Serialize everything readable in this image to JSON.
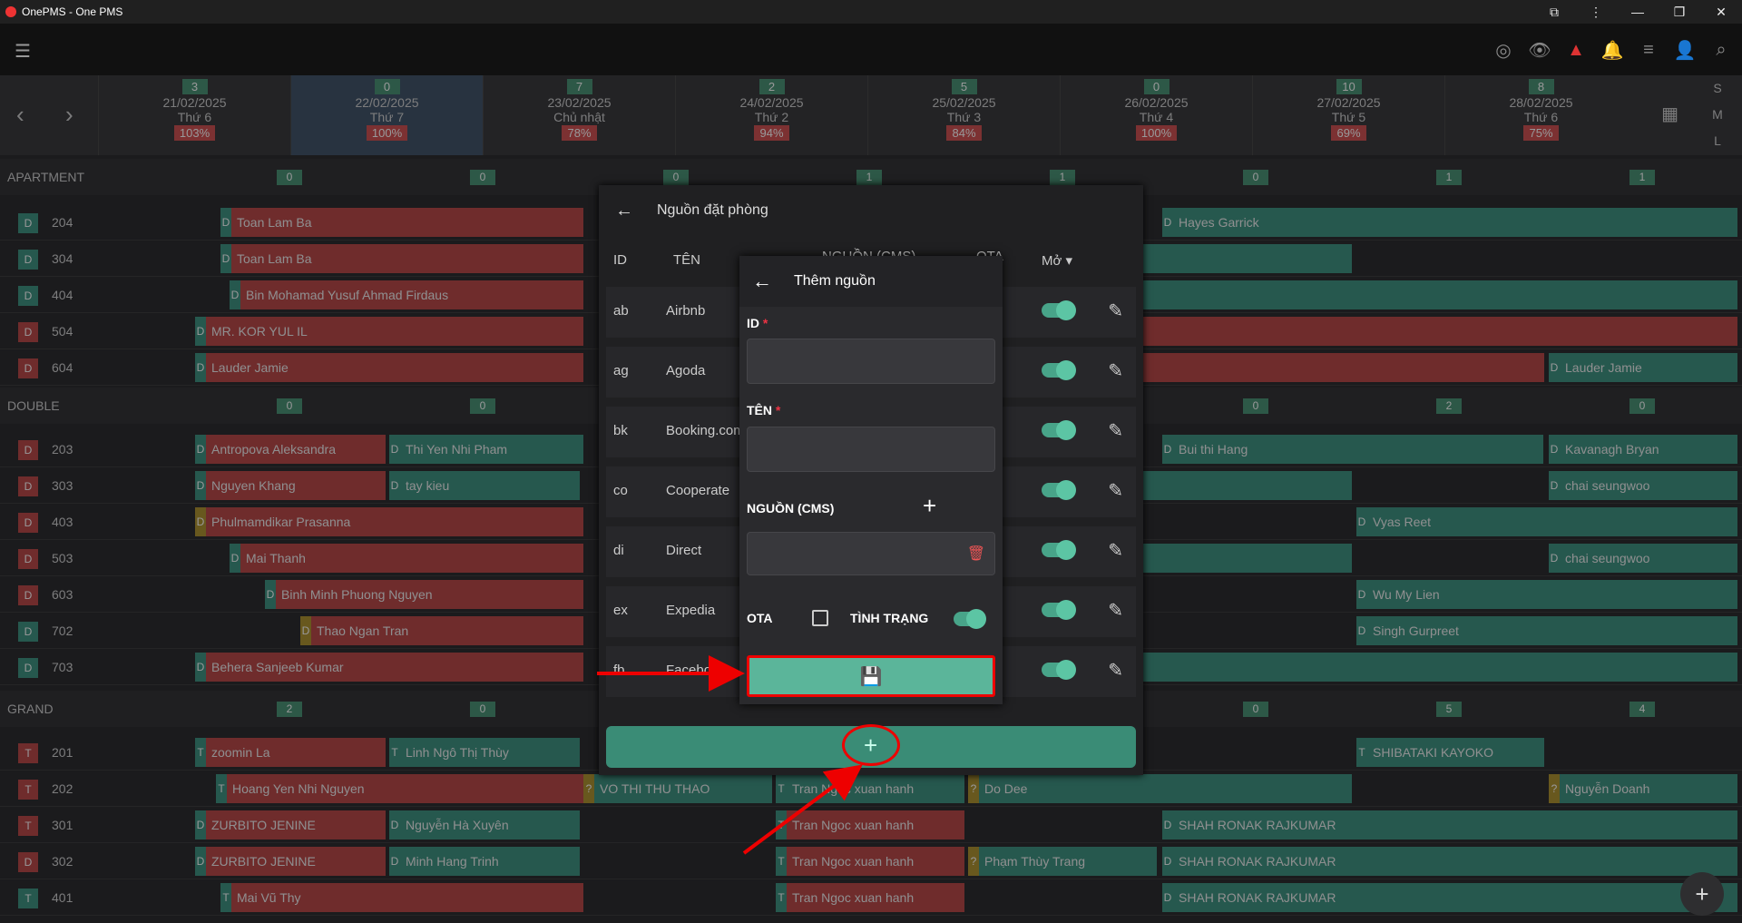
{
  "window": {
    "title": "OnePMS - One PMS"
  },
  "days": [
    {
      "count": "3",
      "date": "21/02/2025",
      "dow": "Thứ 6",
      "occ": "103%"
    },
    {
      "count": "0",
      "date": "22/02/2025",
      "dow": "Thứ 7",
      "occ": "100%"
    },
    {
      "count": "7",
      "date": "23/02/2025",
      "dow": "Chủ nhật",
      "occ": "78%"
    },
    {
      "count": "2",
      "date": "24/02/2025",
      "dow": "Thứ 2",
      "occ": "94%"
    },
    {
      "count": "5",
      "date": "25/02/2025",
      "dow": "Thứ 3",
      "occ": "84%"
    },
    {
      "count": "0",
      "date": "26/02/2025",
      "dow": "Thứ 4",
      "occ": "100%"
    },
    {
      "count": "10",
      "date": "27/02/2025",
      "dow": "Thứ 5",
      "occ": "69%"
    },
    {
      "count": "8",
      "date": "28/02/2025",
      "dow": "Thứ 6",
      "occ": "75%"
    }
  ],
  "sizes": [
    "S",
    "M",
    "L"
  ],
  "groups": {
    "apartment": {
      "label": "APARTMENT",
      "counts": [
        "0",
        "0",
        "0",
        "1",
        "1",
        "0",
        "1",
        "1"
      ]
    },
    "double": {
      "label": "DOUBLE",
      "counts": [
        "0",
        "0",
        "",
        "",
        "",
        "0",
        "2",
        "0"
      ]
    },
    "grand": {
      "label": "GRAND",
      "counts": [
        "2",
        "0",
        "",
        "",
        "",
        "0",
        "5",
        "4"
      ]
    }
  },
  "rooms": [
    {
      "type": "D",
      "num": "204"
    },
    {
      "type": "D",
      "num": "304"
    },
    {
      "type": "D",
      "num": "404"
    },
    {
      "type": "D",
      "num": "504"
    },
    {
      "type": "D",
      "num": "604"
    },
    {
      "type": "D",
      "num": "203"
    },
    {
      "type": "D",
      "num": "303"
    },
    {
      "type": "D",
      "num": "403"
    },
    {
      "type": "D",
      "num": "503"
    },
    {
      "type": "D",
      "num": "603"
    },
    {
      "type": "D",
      "num": "702"
    },
    {
      "type": "D",
      "num": "703"
    },
    {
      "type": "T",
      "num": "201"
    },
    {
      "type": "T",
      "num": "202"
    },
    {
      "type": "T",
      "num": "301"
    },
    {
      "type": "D",
      "num": "302"
    },
    {
      "type": "T",
      "num": "401"
    }
  ],
  "bookings": {
    "b0": "Toan Lam Ba",
    "b1": "Hayes Garrick",
    "b2": "Toan Lam Ba",
    "b3": "Bin Mohamad Yusuf Ahmad Firdaus",
    "b4": "MR. KOR YUL IL",
    "b5": "Lauder Jamie",
    "b6": "Lauder Jamie",
    "b7": "Antropova Aleksandra",
    "b8": "Thi Yen Nhi Pham",
    "b9": "Bui thi Hang",
    "b10": "Kavanagh Bryan",
    "b11": "Nguyen Khang",
    "b12": "tay kieu",
    "b13": "chai seungwoo",
    "b14": "Phulmamdikar Prasanna",
    "b15": "Vyas Reet",
    "b16": "Mai Thanh",
    "b17": "chai seungwoo",
    "b18": "Binh Minh Phuong Nguyen",
    "b19": "Wu My Lien",
    "b20": "Thao Ngan Tran",
    "b21": "Singh Gurpreet",
    "b22": "Behera Sanjeeb Kumar",
    "b23": "zoomin La",
    "b24": "Linh Ngô Thị Thùy",
    "b25": "SHIBATAKI KAYOKO",
    "b26": "Hoang Yen Nhi Nguyen",
    "b27": "VO THI THU THAO",
    "b28": "Tran Ngoc xuan hanh",
    "b29": "Do Dee",
    "b30": "Nguyễn Doanh",
    "b31": "ZURBITO JENINE",
    "b32": "Nguyễn Hà Xuyên",
    "b33": "Tran Ngoc xuan hanh",
    "b34": "SHAH RONAK RAJKUMAR",
    "b35": "ZURBITO JENINE",
    "b36": "Minh Hang Trinh",
    "b37": "Tran Ngoc xuan hanh",
    "b38": "Phạm Thùy Trang",
    "b39": "SHAH RONAK RAJKUMAR",
    "b40": "Mai Vũ Thy",
    "b41": "Tran Ngoc xuan hanh",
    "b42": "SHAH RONAK RAJKUMAR"
  },
  "panel": {
    "title": "Nguồn đặt phòng",
    "col_id": "ID",
    "col_name": "TÊN",
    "col_src": "NGUỒN (CMS)",
    "col_ota": "OTA",
    "col_open": "Mở",
    "rows": [
      {
        "id": "ab",
        "name": "Airbnb"
      },
      {
        "id": "ag",
        "name": "Agoda"
      },
      {
        "id": "bk",
        "name": "Booking.com"
      },
      {
        "id": "co",
        "name": "Cooperate"
      },
      {
        "id": "di",
        "name": "Direct"
      },
      {
        "id": "ex",
        "name": "Expedia"
      },
      {
        "id": "fb",
        "name": "Facebook"
      }
    ]
  },
  "dialog": {
    "title": "Thêm nguồn",
    "id_label": "ID",
    "name_label": "TÊN",
    "source_label": "NGUỒN (CMS)",
    "ota_label": "OTA",
    "status_label": "TÌNH TRẠNG",
    "required_mark": "*"
  },
  "colors": {
    "accent": "#5bb59a",
    "annotation": "#e00000",
    "booked_red": "#b43a3a",
    "booked_teal": "#2f8a76"
  }
}
